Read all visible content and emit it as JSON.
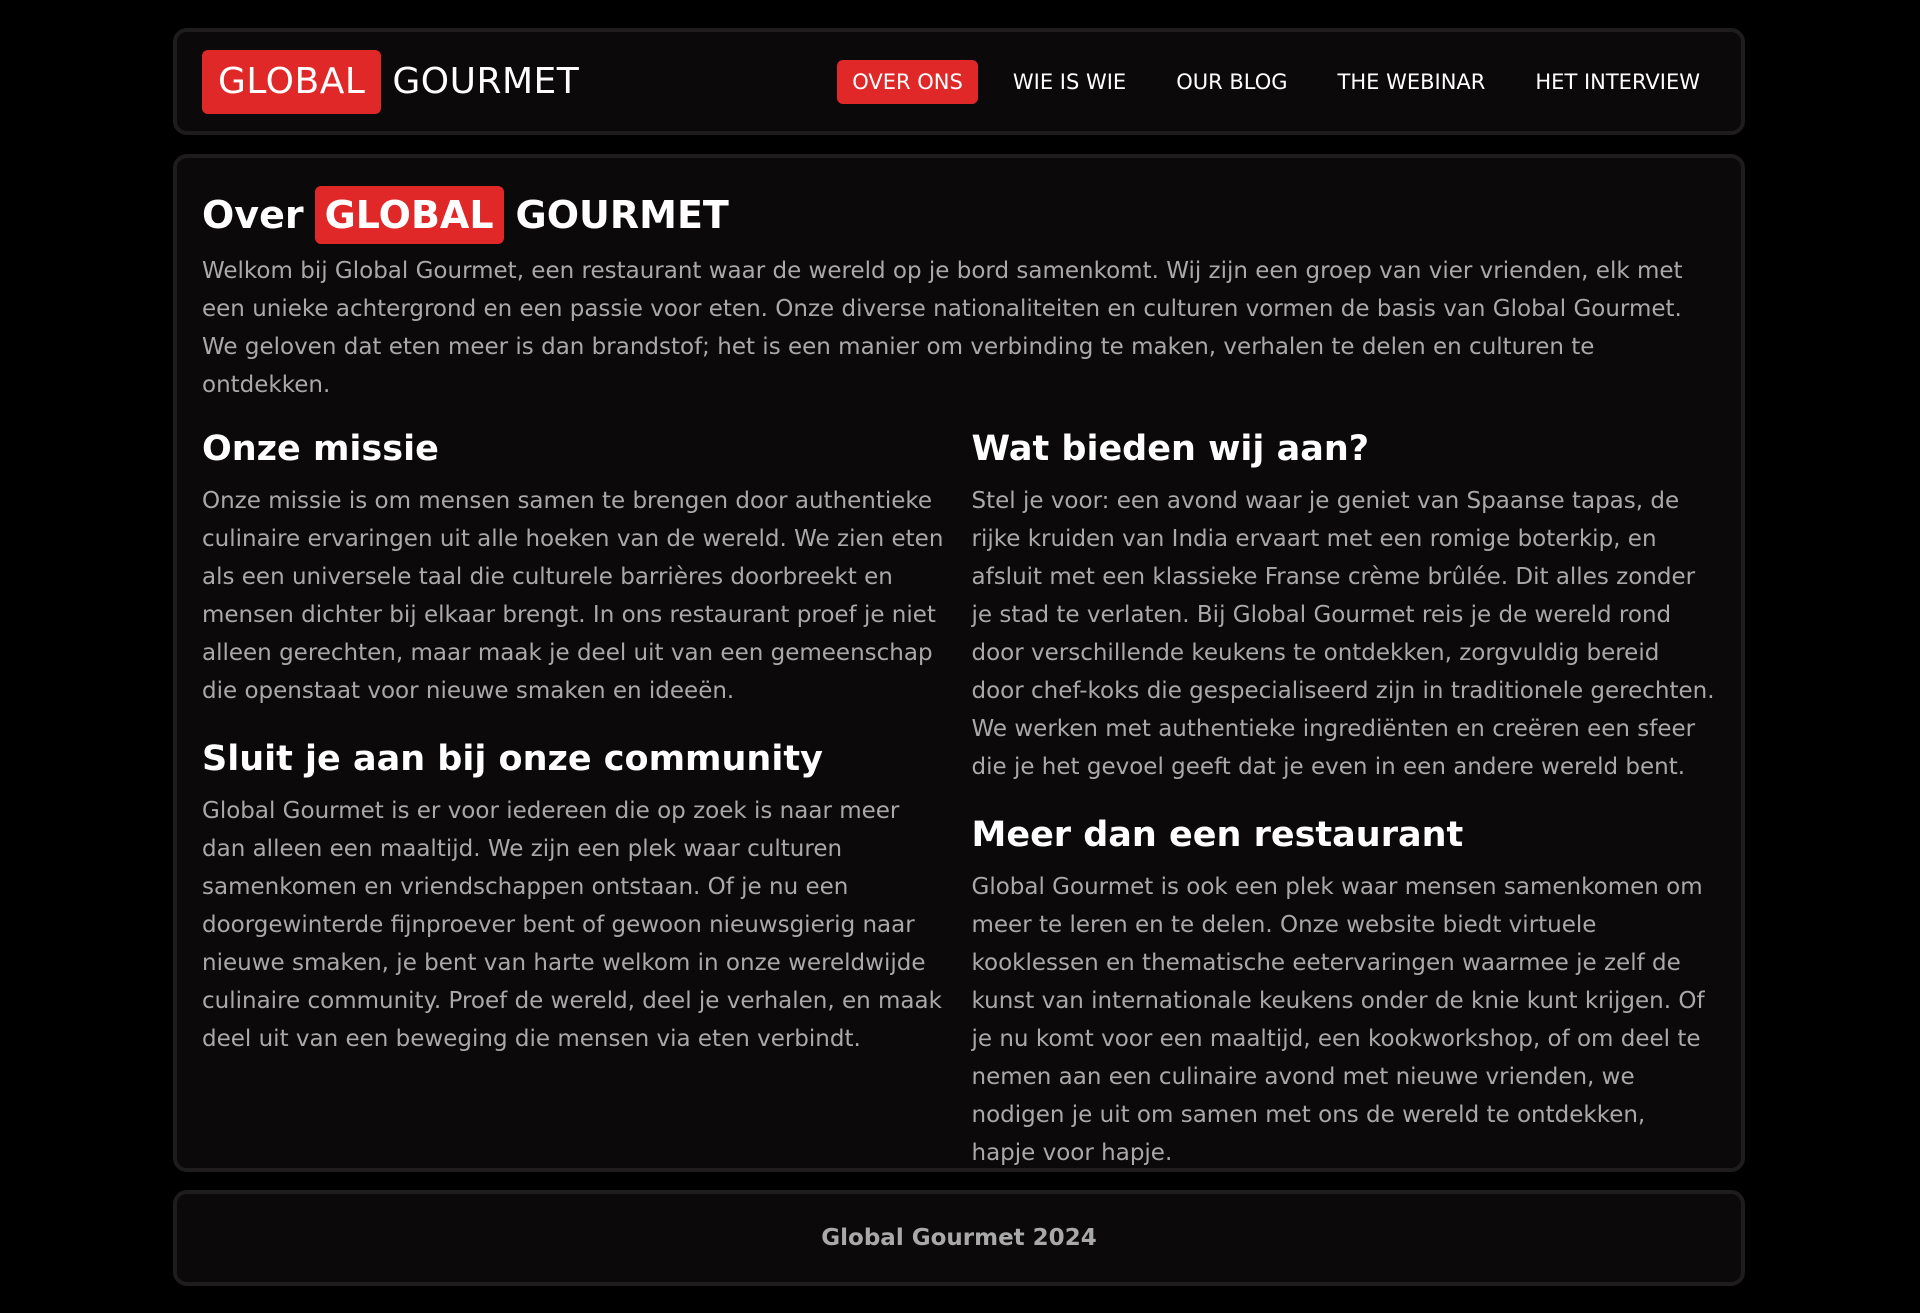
{
  "header": {
    "logo_highlight": "GLOBAL",
    "logo_rest": "GOURMET",
    "nav": [
      {
        "label": "OVER ONS"
      },
      {
        "label": "WIE IS WIE"
      },
      {
        "label": "OUR BLOG"
      },
      {
        "label": "THE WEBINAR"
      },
      {
        "label": "HET INTERVIEW"
      }
    ],
    "active_nav": "OVER ONS"
  },
  "main": {
    "title_prefix": "Over",
    "title_highlight": "GLOBAL",
    "title_rest": "GOURMET",
    "intro": "Welkom bij Global Gourmet, een restaurant waar de wereld op je bord samenkomt. Wij zijn een groep van vier vrienden, elk met een unieke achtergrond en een passie voor eten. Onze diverse nationaliteiten en culturen vormen de basis van Global Gourmet. We geloven dat eten meer is dan brandstof; het is een manier om verbinding te maken, verhalen te delen en culturen te ontdekken.",
    "sections_left": [
      {
        "title": "Onze missie",
        "text": "Onze missie is om mensen samen te brengen door authentieke culinaire ervaringen uit alle hoeken van de wereld. We zien eten als een universele taal die culturele barrières doorbreekt en mensen dichter bij elkaar brengt. In ons restaurant proef je niet alleen gerechten, maar maak je deel uit van een gemeenschap die openstaat voor nieuwe smaken en ideeën."
      },
      {
        "title": "Sluit je aan bij onze community",
        "text": "Global Gourmet is er voor iedereen die op zoek is naar meer dan alleen een maaltijd. We zijn een plek waar culturen samenkomen en vriendschappen ontstaan. Of je nu een doorgewinterde fijnproever bent of gewoon nieuwsgierig naar nieuwe smaken, je bent van harte welkom in onze wereldwijde culinaire community. Proef de wereld, deel je verhalen, en maak deel uit van een beweging die mensen via eten verbindt."
      }
    ],
    "sections_right": [
      {
        "title": "Wat bieden wij aan?",
        "text": "Stel je voor: een avond waar je geniet van Spaanse tapas, de rijke kruiden van India ervaart met een romige boterkip, en afsluit met een klassieke Franse crème brûlée. Dit alles zonder je stad te verlaten. Bij Global Gourmet reis je de wereld rond door verschillende keukens te ontdekken, zorgvuldig bereid door chef-koks die gespecialiseerd zijn in traditionele gerechten. We werken met authentieke ingrediënten en creëren een sfeer die je het gevoel geeft dat je even in een andere wereld bent."
      },
      {
        "title": "Meer dan een restaurant",
        "text": "Global Gourmet is ook een plek waar mensen samenkomen om meer te leren en te delen. Onze website biedt virtuele kooklessen en thematische eetervaringen waarmee je zelf de kunst van internationale keukens onder de knie kunt krijgen. Of je nu komt voor een maaltijd, een kookworkshop, of om deel te nemen aan een culinaire avond met nieuwe vrienden, we nodigen je uit om samen met ons de wereld te ontdekken, hapje voor hapje."
      }
    ]
  },
  "footer": {
    "text": "Global Gourmet 2024"
  },
  "colors": {
    "accent": "#e02828",
    "background": "#000000",
    "panel": "#0b0909",
    "panel_border": "#1e1c1c",
    "body_text": "#a9a9a9",
    "heading_text": "#ffffff"
  }
}
